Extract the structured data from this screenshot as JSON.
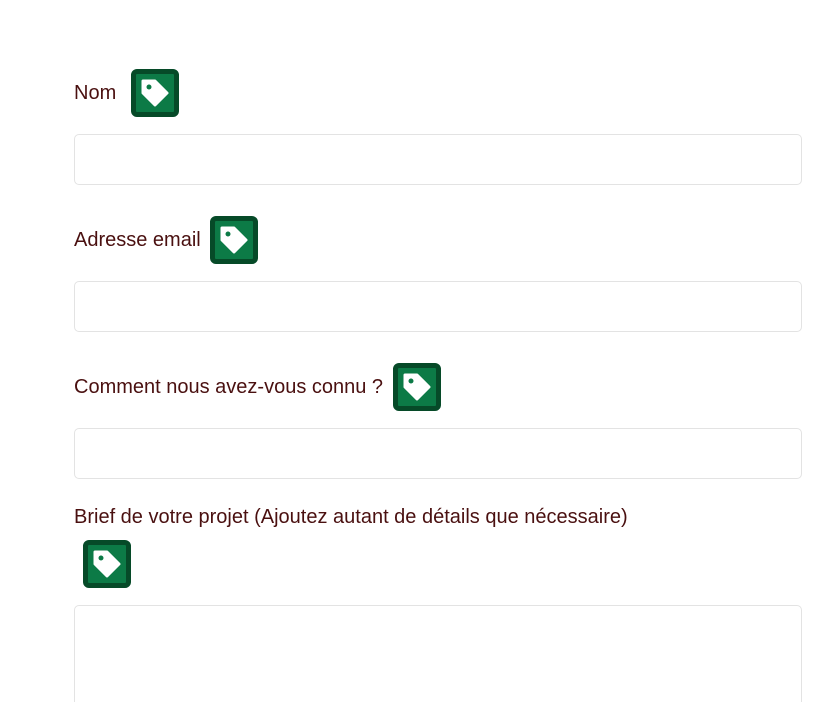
{
  "form": {
    "fields": [
      {
        "label": "Nom",
        "value": "",
        "icon": "tag-icon"
      },
      {
        "label": "Adresse email",
        "value": "",
        "icon": "tag-icon"
      },
      {
        "label": "Comment nous avez-vous connu ?",
        "value": "",
        "icon": "tag-icon"
      },
      {
        "label": "Brief de votre projet (Ajoutez autant de détails que nécessaire)",
        "value": "",
        "icon": "tag-icon"
      }
    ]
  },
  "colors": {
    "label_text": "#4a1010",
    "icon_fill": "#0c7a46",
    "icon_border": "#064a28",
    "field_border": "#e3e3e3"
  }
}
